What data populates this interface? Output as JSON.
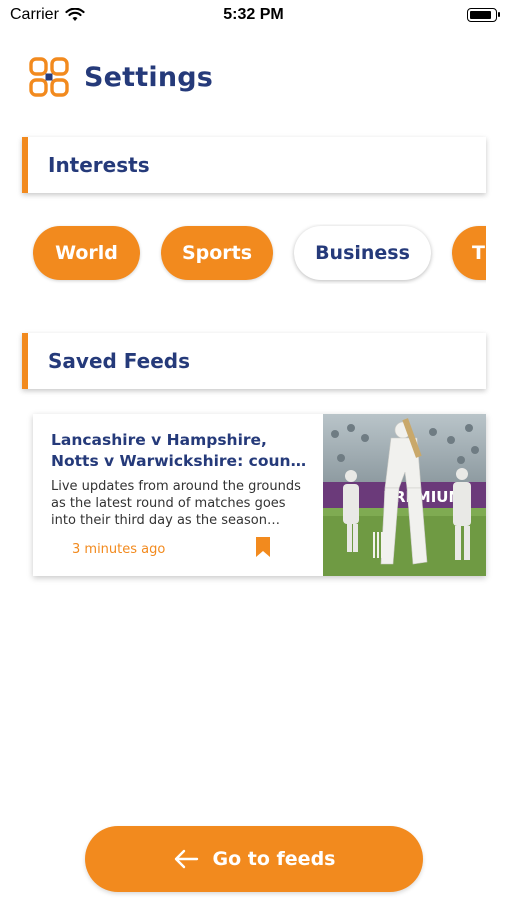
{
  "status_bar": {
    "carrier": "Carrier",
    "time": "5:32 PM",
    "battery_level": 0.9
  },
  "header": {
    "logo_icon": "grid-logo-icon",
    "title": "Settings"
  },
  "interests": {
    "title": "Interests",
    "chips": [
      {
        "label": "World",
        "selected": true
      },
      {
        "label": "Sports",
        "selected": true
      },
      {
        "label": "Business",
        "selected": false
      },
      {
        "label": "T",
        "selected": true
      }
    ]
  },
  "saved_feeds": {
    "title": "Saved Feeds",
    "items": [
      {
        "title": "Lancashire v Hampshire, Notts v Warwickshire: county cricket",
        "description": "Live updates from around the grounds as the latest round of matches goes into their third day as the season continues",
        "time": "3 minutes ago",
        "bookmark_icon": "bookmark-icon",
        "image_sign_text": "PREMIUM"
      }
    ]
  },
  "footer": {
    "go_to_feeds_label": "Go to feeds",
    "icon": "arrow-left-icon"
  },
  "colors": {
    "accent": "#f28a1e",
    "navy": "#253a7a"
  }
}
